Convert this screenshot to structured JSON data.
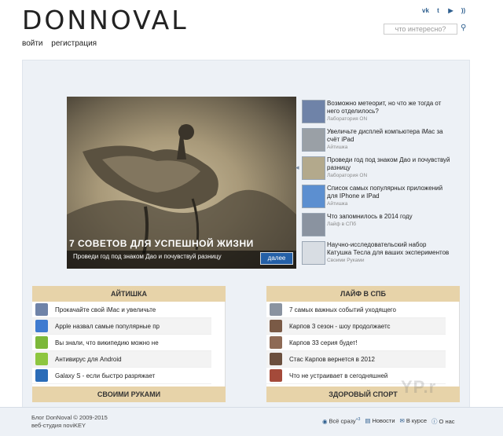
{
  "site": {
    "logo": "DONNOVAL",
    "social_icons": [
      "vk-icon",
      "twitter-icon",
      "youtube-icon",
      "rss-icon"
    ],
    "search_placeholder": "что интересно?",
    "login": "войти",
    "register": "регистрация"
  },
  "slider": {
    "title": "7 СОВЕТОВ ДЛЯ УСПЕШНОЙ ЖИЗНИ",
    "subtitle": "Проведи год под знаком Дао и почувствуй разницу",
    "more": "далее"
  },
  "news": [
    {
      "title": "Возможно метеорит, но что же тогда от него отделилось?",
      "category": "Лаборатория ON"
    },
    {
      "title": "Увеличьте дисплей компьютера iMac за счёт iPad",
      "category": "Айтишка"
    },
    {
      "title": "Проведи год под знаком Дао и почувствуй разницу",
      "category": "Лаборатория ON"
    },
    {
      "title": "Список самых популярных приложений для IPhone и IPad",
      "category": "Айтишка"
    },
    {
      "title": "Что запомнилось в 2014 году",
      "category": "Лайф в СПб"
    },
    {
      "title": "Научно-исследовательский набор Катушка Тесла для ваших экспериментов",
      "category": "Своими Руками"
    }
  ],
  "sections": {
    "aitishka": {
      "title": "АЙТИШКА",
      "items": [
        "Прокачайте свой iMac и увеличьте",
        "Apple назвал самые популярные пр",
        "Вы знали, что википедию можно не",
        "Антивирус для Android",
        "Galaxy S - если быстро разряжает"
      ]
    },
    "life_spb": {
      "title": "ЛАЙФ В СПБ",
      "items": [
        "7 самых важных событий уходящего",
        "Карпов 3 сезон - шоу продолжаетс",
        "Карпов 33 серия будет!",
        "Стас Карпов вернется в 2012",
        "Что не устраивает в сегодняшней"
      ]
    },
    "own_hands": {
      "title": "СВОИМИ РУКАМИ"
    },
    "healthy_sport": {
      "title": "ЗДОРОВЫЙ СПОРТ"
    }
  },
  "footer": {
    "copyright": "Блог DonNoval © 2009-2015",
    "studio": "веб-студия noviKEY",
    "links": [
      "Всё сразу",
      "Новости",
      "В курсе",
      "О нас"
    ],
    "vse_sup": "+3"
  },
  "watermark": "YP.r"
}
